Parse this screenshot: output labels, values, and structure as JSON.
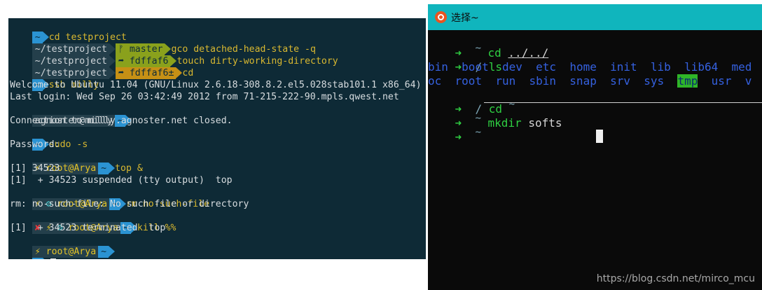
{
  "left_terminal": {
    "l1": {
      "tilde": "~",
      "cmd": "cd testproject"
    },
    "l2": {
      "path": "~/testproject",
      "git": "ᚠ master",
      "cmd": "gco detached-head-state -q"
    },
    "l3": {
      "path": "~/testproject",
      "git": "➦ fdffaf6",
      "cmd": "touch dirty-working-directory"
    },
    "l4": {
      "path": "~/testproject",
      "git": "➦ fdffaf6±",
      "cmd": "cd"
    },
    "l5": {
      "tilde": "~",
      "cmd": "ssh milly"
    },
    "l6": "Welcome to Ubuntu 11.04 (GNU/Linux 2.6.18-308.8.2.el5.028stab101.1 x86_64)",
    "l7": "Last login: Wed Sep 26 03:42:49 2012 from 71-215-222-90.mpls.qwest.net",
    "l8": {
      "user": "agnoster@milly",
      "tilde": "~"
    },
    "l9": "Connection to milly.agnoster.net closed.",
    "l10": {
      "tilde": "~",
      "cmd": "sudo -s"
    },
    "l11": "Password:",
    "l12": {
      "bolt": "⚡",
      "user": "root@Arya",
      "tilde": "~",
      "cmd": "top &"
    },
    "l13": "[1] 34523",
    "l14": "[1]  + 34523 suspended (tty output)  top",
    "l15": {
      "bolt": "⚡",
      "gear": "⚙",
      "user": "root@Arya",
      "tilde": "~",
      "cmd": "rm no-such-file"
    },
    "l16": "rm: no-such-file: No such file or directory",
    "l17": {
      "cross": "✘",
      "bolt": "⚡",
      "gear": "⚙",
      "user": "root@Arya",
      "tilde": "~",
      "cmd": "kill %%"
    },
    "l18": "[1]  + 34523 terminated  top",
    "l19": {
      "bolt": "⚡",
      "user": "root@Arya",
      "tilde": "~"
    },
    "l20": {
      "tilde": "~"
    }
  },
  "right_window": {
    "title": "选择~",
    "prompt_arrow": "➜",
    "tilde": "~",
    "r1": {
      "cmd": "cd",
      "arg": "../../"
    },
    "r2": {
      "path": "/",
      "cmd": "ls"
    },
    "r3": [
      "bin",
      "boot",
      "dev",
      "etc",
      "home",
      "init",
      "lib",
      "lib64",
      "med"
    ],
    "r4": [
      "oc",
      "root",
      "run",
      "sbin",
      "snap",
      "srv",
      "sys",
      "tmp",
      "usr",
      "v"
    ],
    "r5": {
      "path": "/",
      "cmd": "cd",
      "arg": "~"
    },
    "r6": {
      "cmd": "mkdir",
      "arg": "softs"
    }
  },
  "watermark": "https://blog.csdn.net/mirco_mcu",
  "colors": {
    "left_bg": "#0e2a36",
    "titlebar": "#10b5bd",
    "prompt_blue": "#2b93d2",
    "git_green": "#8aa11c",
    "git_yellow": "#c69015",
    "prompt_arrow_green": "#2fcf42",
    "dir_blue": "#3561e0"
  }
}
